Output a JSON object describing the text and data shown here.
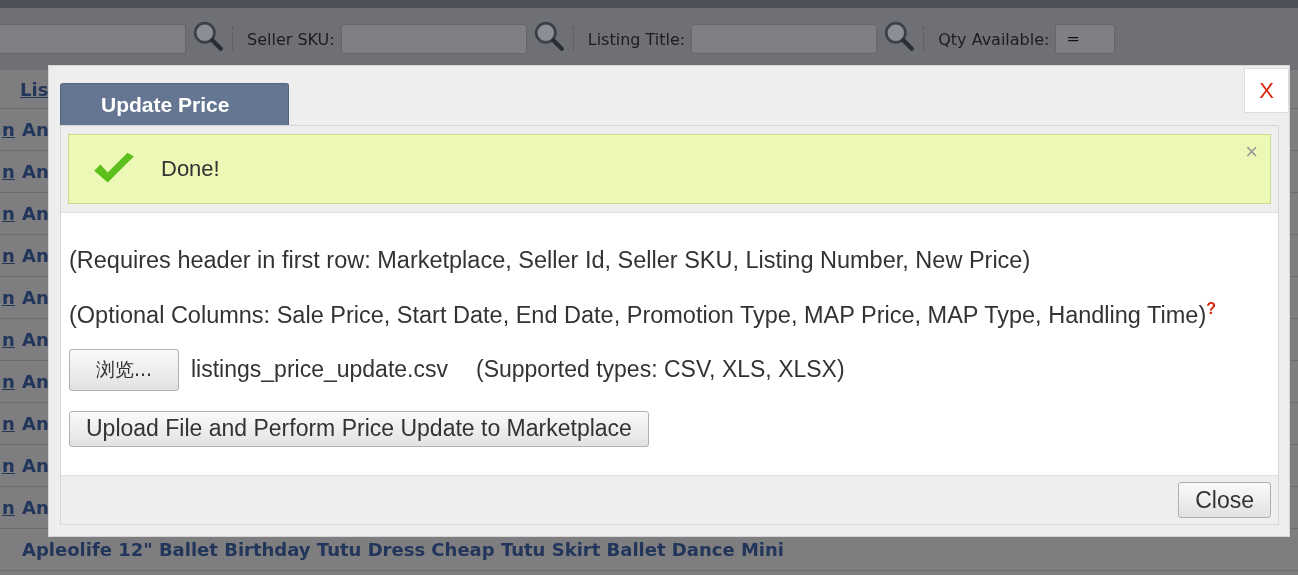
{
  "filters": [
    {
      "kind": "search"
    },
    {
      "kind": "search",
      "label": "Seller SKU:"
    },
    {
      "kind": "search",
      "label": "Listing Title:"
    },
    {
      "kind": "select",
      "label": "Qty Available:",
      "value": "="
    }
  ],
  "table": {
    "header": "Lis",
    "rows": [
      {
        "column_1": "n",
        "column_2": "An"
      },
      {
        "column_1": "n",
        "column_2": "An"
      },
      {
        "column_1": "n",
        "column_2": "An"
      },
      {
        "column_1": "n",
        "column_2": "An"
      },
      {
        "column_1": "n",
        "column_2": "An"
      },
      {
        "column_1": "n",
        "column_2": "An"
      },
      {
        "column_1": "n",
        "column_2": "An"
      },
      {
        "column_1": "n",
        "column_2": "An"
      },
      {
        "column_1": "n",
        "column_2": "An"
      },
      {
        "column_1": "n",
        "column_2": "An"
      },
      {
        "column_2": "Apleolife 12\" Ballet Birthday Tutu Dress Cheap Tutu Skirt Ballet Dance Mini"
      }
    ]
  },
  "dialog": {
    "close_mark": "X",
    "tabs": [
      {
        "label": "Update Price",
        "selected": true
      }
    ],
    "alert": {
      "message": "Done!",
      "dismiss": "×"
    },
    "lines": [
      {
        "text": "(Requires header in first row: Marketplace, Seller Id, Seller SKU, Listing Number, New Price)"
      },
      {
        "text": "(Optional Columns: Sale Price, Start Date, End Date, Promotion Type, MAP Price, MAP Type, Handling Time)",
        "help_mark": "?"
      }
    ],
    "file": {
      "button": "浏览...",
      "name": "listings_price_update.csv",
      "hint": "(Supported types: CSV, XLS, XLSX)"
    },
    "upload_button": "Upload File and Perform Price Update to Marketplace",
    "close_button": "Close"
  }
}
